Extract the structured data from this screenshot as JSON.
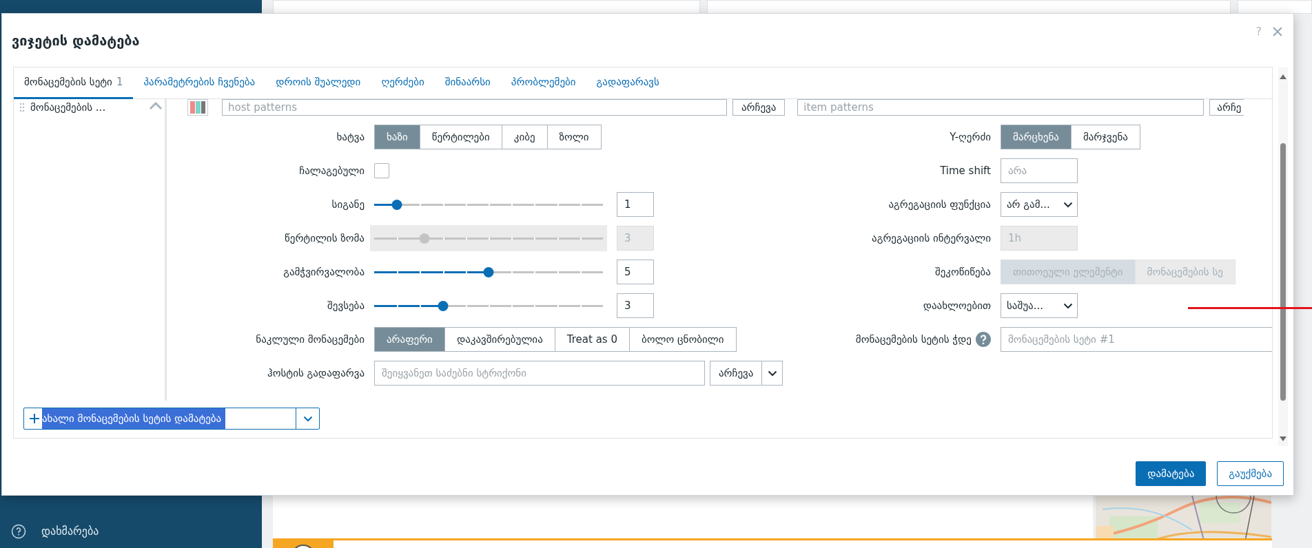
{
  "dialog": {
    "title": "ვიჯეტის დამატება",
    "help": "?"
  },
  "tabs": [
    {
      "label": "მონაცემების სეტი",
      "count": "1",
      "selected": true
    },
    {
      "label": "პარამეტრების ჩვენება",
      "selected": false
    },
    {
      "label": "დროის შუალედი",
      "selected": false
    },
    {
      "label": "ღერძები",
      "selected": false
    },
    {
      "label": "შინაარსი",
      "selected": false
    },
    {
      "label": "პრობლემები",
      "selected": false
    },
    {
      "label": "გადაფარავს",
      "selected": false
    }
  ],
  "dataset_list": {
    "items": [
      {
        "label": "მონაცემების ..."
      }
    ]
  },
  "dataset_row": {
    "host_placeholder": "host patterns",
    "host_button": "არჩევა",
    "item_placeholder": "item patterns",
    "item_button": "არჩე"
  },
  "left_fields": [
    {
      "kind": "segmented",
      "label": "ხატვა",
      "disabled": false,
      "options": [
        {
          "label": "ხაზი",
          "selected": true
        },
        {
          "label": "წერტილები",
          "selected": false
        },
        {
          "label": "კიბე",
          "selected": false
        },
        {
          "label": "ზოლი",
          "selected": false
        }
      ]
    },
    {
      "kind": "checkbox",
      "label": "ჩალაგებული",
      "checked": false
    },
    {
      "kind": "slider",
      "label": "სიგანე",
      "level": 0.1,
      "value": "1",
      "disabled": false
    },
    {
      "kind": "slider",
      "label": "წერტილის ზომა",
      "level": 0.22,
      "value": "3",
      "disabled": true
    },
    {
      "kind": "slider",
      "label": "გამჭვირვალობა",
      "level": 0.5,
      "value": "5",
      "disabled": false
    },
    {
      "kind": "slider",
      "label": "შევსება",
      "level": 0.3,
      "value": "3",
      "disabled": false
    },
    {
      "kind": "segmented",
      "label": "ნაკლული მონაცემები",
      "disabled": false,
      "options": [
        {
          "label": "არაფერი",
          "selected": true
        },
        {
          "label": "დაკავშირებულია",
          "selected": false
        },
        {
          "label": "Treat as 0",
          "selected": false
        },
        {
          "label": "ბოლო ცნობილი",
          "selected": false
        }
      ]
    },
    {
      "kind": "input_select",
      "label": "ჰოსტის გადაფარვა",
      "placeholder": "შეიყვანეთ საძებნი სტრიქონი",
      "button": "არჩევა"
    }
  ],
  "right_fields": [
    {
      "kind": "segmented",
      "label": "Y-ღერძი",
      "disabled": false,
      "options": [
        {
          "label": "მარცხენა",
          "selected": true
        },
        {
          "label": "მარჯვენა",
          "selected": false
        }
      ]
    },
    {
      "kind": "input",
      "label": "Time shift",
      "placeholder": "არა",
      "disabled": false
    },
    {
      "kind": "select",
      "label": "აგრეგაციის ფუნქცია",
      "value": "არ გამ..."
    },
    {
      "kind": "input",
      "label": "აგრეგაციის ინტერვალი",
      "value": "1h",
      "disabled": true
    },
    {
      "kind": "segmented",
      "label": "შეკოწიწება",
      "disabled": true,
      "options": [
        {
          "label": "თითოეული ელემენტი",
          "selected": true
        },
        {
          "label": "მონაცემების სე",
          "selected": false
        }
      ]
    },
    {
      "kind": "select",
      "label": "დაახლოებით",
      "value": "საშუა..."
    },
    {
      "kind": "input",
      "label": "მონაცემების სეტის ჭდე",
      "help": true,
      "placeholder": "მონაცემების სეტი #1",
      "disabled": false
    }
  ],
  "add_dataset": {
    "label": "ახალი მონაცემების სეტის დამატება",
    "highlighted": true
  },
  "footer": {
    "buttons": [
      {
        "label": "დამატება",
        "primary": true
      },
      {
        "label": "გაუქმება",
        "primary": false
      }
    ]
  },
  "background": {
    "sidebar_items": [
      {
        "label": "დახმარება"
      }
    ]
  }
}
